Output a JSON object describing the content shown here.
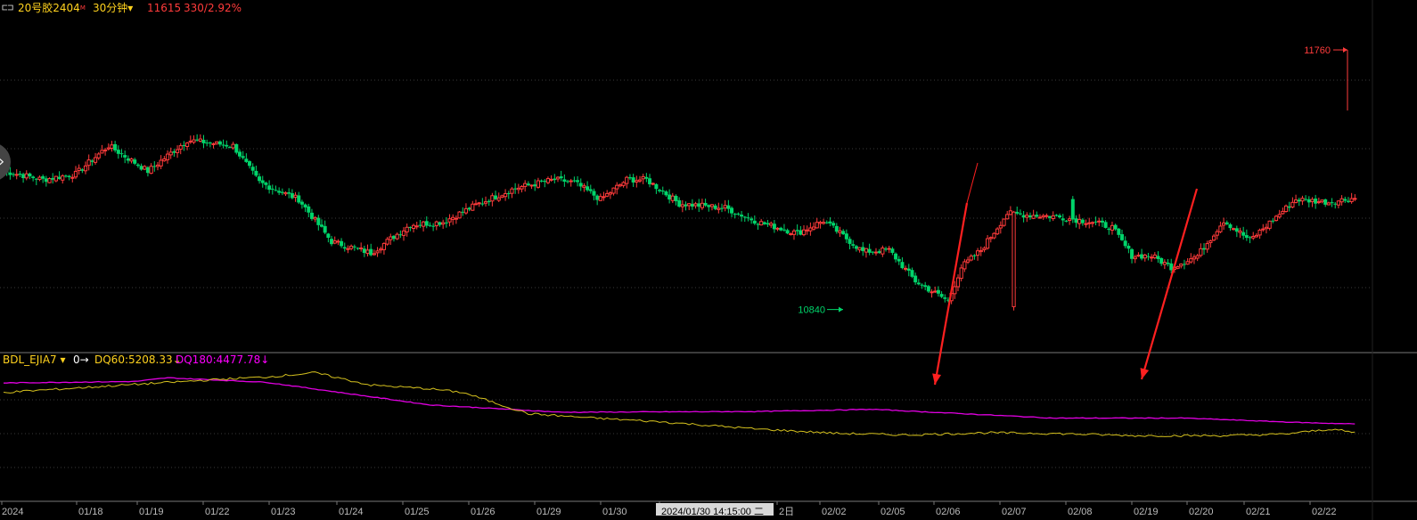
{
  "header": {
    "symbol_icon": "⊏⊐",
    "symbol": "20号胶2404",
    "symbol_badge": "M",
    "period": "30分钟",
    "period_arrow": "▾",
    "price": "11615",
    "change": "330/2.92%"
  },
  "indicator": {
    "name": "BDL_EJIA7",
    "name_arrow": "▾",
    "zero_label": "0→",
    "dq60_label": "DQ60:5208.33↓",
    "dq180_label": "DQ180:4477.78↓"
  },
  "colors": {
    "up": "#ff3b3b",
    "down": "#00d46a",
    "dq60": "#d6c21e",
    "dq180": "#e000e0",
    "arrow": "#ff2020",
    "grid": "#3a3a3a",
    "axis": "#777777"
  },
  "chart_data": [
    {
      "type": "candlestick",
      "title": "20号胶2404 30分钟",
      "y_range": [
        10700,
        11880
      ],
      "max_label": "11760",
      "min_label": "10840",
      "x_tick_labels": [
        "2024",
        "01/18",
        "01/19",
        "01/22",
        "01/23",
        "01/24",
        "01/25",
        "01/26",
        "01/29",
        "01/30",
        "2024/01/30 14:15:00 二",
        "2日",
        "02/02",
        "02/05",
        "02/06",
        "02/07",
        "02/08",
        "02/19",
        "02/20",
        "02/21",
        "02/22"
      ],
      "anchor_closes": [
        [
          0,
          11330
        ],
        [
          12,
          11300
        ],
        [
          22,
          11320
        ],
        [
          32,
          11420
        ],
        [
          44,
          11330
        ],
        [
          56,
          11440
        ],
        [
          70,
          11420
        ],
        [
          78,
          11290
        ],
        [
          90,
          11230
        ],
        [
          100,
          11080
        ],
        [
          112,
          11040
        ],
        [
          124,
          11140
        ],
        [
          134,
          11150
        ],
        [
          144,
          11210
        ],
        [
          156,
          11270
        ],
        [
          168,
          11300
        ],
        [
          174,
          11290
        ],
        [
          182,
          11230
        ],
        [
          190,
          11300
        ],
        [
          196,
          11300
        ],
        [
          206,
          11215
        ],
        [
          220,
          11200
        ],
        [
          230,
          11150
        ],
        [
          242,
          11110
        ],
        [
          250,
          11155
        ],
        [
          262,
          11045
        ],
        [
          270,
          11050
        ],
        [
          278,
          10940
        ],
        [
          288,
          10870
        ],
        [
          292,
          10990
        ],
        [
          298,
          11050
        ],
        [
          306,
          11180
        ],
        [
          312,
          11175
        ],
        [
          320,
          11170
        ],
        [
          332,
          11150
        ],
        [
          338,
          11130
        ],
        [
          344,
          11030
        ],
        [
          350,
          11030
        ],
        [
          356,
          10990
        ],
        [
          364,
          11030
        ],
        [
          372,
          11155
        ],
        [
          380,
          11085
        ],
        [
          394,
          11230
        ],
        [
          404,
          11220
        ],
        [
          412,
          11235
        ]
      ]
    },
    {
      "type": "line",
      "series_names": [
        "DQ60",
        "DQ180"
      ],
      "y_range": [
        4400,
        6200
      ],
      "DQ60": [
        [
          0,
          5850
        ],
        [
          40,
          5960
        ],
        [
          70,
          6040
        ],
        [
          80,
          6060
        ],
        [
          95,
          6120
        ],
        [
          112,
          5950
        ],
        [
          130,
          5900
        ],
        [
          140,
          5850
        ],
        [
          160,
          5560
        ],
        [
          180,
          5500
        ],
        [
          200,
          5450
        ],
        [
          230,
          5350
        ],
        [
          255,
          5290
        ],
        [
          275,
          5270
        ],
        [
          300,
          5300
        ],
        [
          320,
          5290
        ],
        [
          345,
          5260
        ],
        [
          372,
          5260
        ],
        [
          390,
          5280
        ],
        [
          405,
          5350
        ],
        [
          412,
          5300
        ]
      ],
      "DQ180": [
        [
          0,
          5980
        ],
        [
          40,
          6000
        ],
        [
          50,
          6050
        ],
        [
          80,
          5990
        ],
        [
          130,
          5680
        ],
        [
          170,
          5580
        ],
        [
          230,
          5590
        ],
        [
          265,
          5620
        ],
        [
          320,
          5500
        ],
        [
          360,
          5500
        ],
        [
          395,
          5440
        ],
        [
          412,
          5420
        ]
      ]
    }
  ]
}
